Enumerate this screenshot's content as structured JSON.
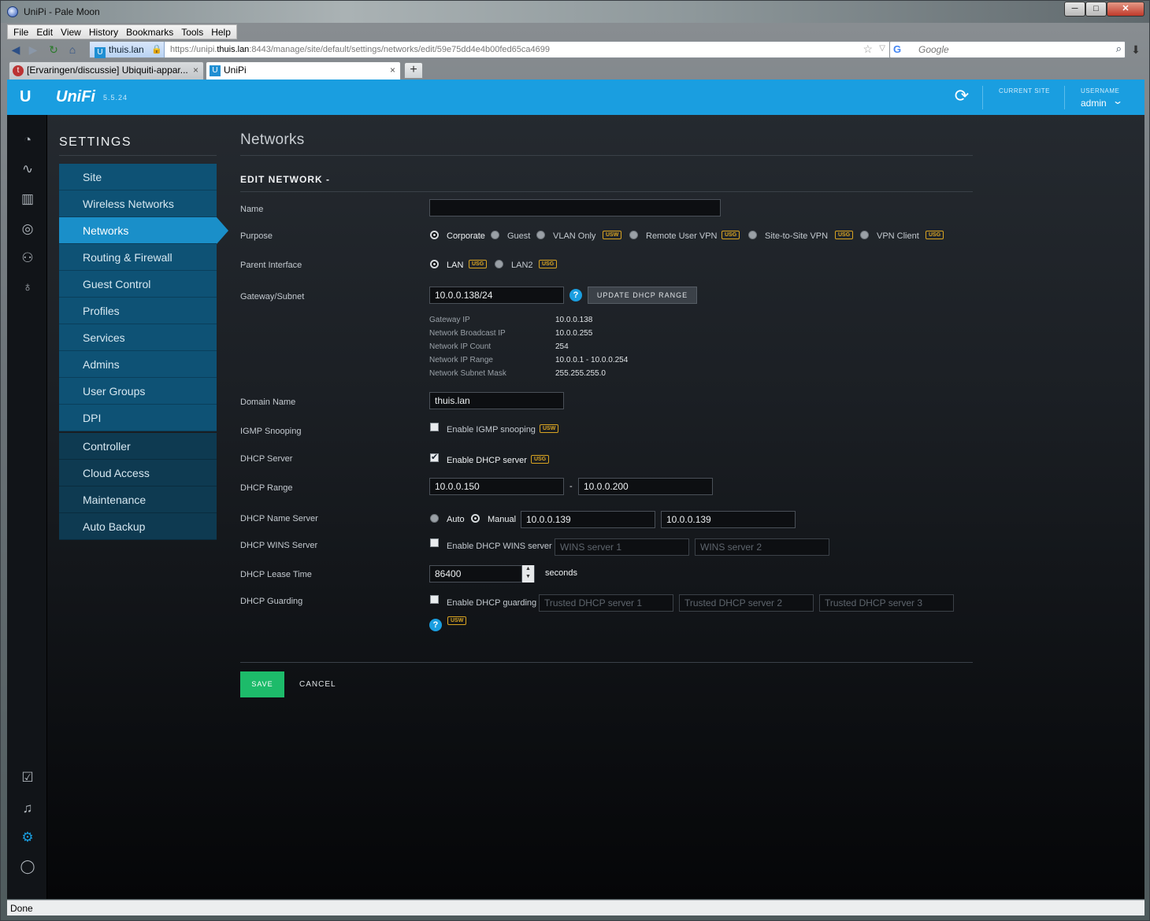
{
  "window": {
    "title": "UniPi - Pale Moon",
    "min": "─",
    "max": "□",
    "close": "✕"
  },
  "menu": [
    "File",
    "Edit",
    "View",
    "History",
    "Bookmarks",
    "Tools",
    "Help"
  ],
  "nav": {
    "identity": "thuis.lan",
    "url_prefix": "https://unipi.",
    "url_host": "thuis.lan",
    "url_rest": ":8443/manage/site/default/settings/networks/edit/59e75dd4e4b00fed65ca4699",
    "search_placeholder": "Google"
  },
  "tabs": [
    {
      "label": "[Ervaringen/discussie] Ubiquiti-appar...",
      "icon": "tweakers-icon"
    },
    {
      "label": "UniPi",
      "icon": "unifi-icon"
    }
  ],
  "app": {
    "logo": "UniFi",
    "version": "5.5.24",
    "current_site_label": "CURRENT SITE",
    "username_label": "USERNAME",
    "username": "admin"
  },
  "settings": {
    "title": "SETTINGS",
    "menu_top": [
      "Site",
      "Wireless Networks",
      "Networks",
      "Routing & Firewall",
      "Guest Control",
      "Profiles",
      "Services",
      "Admins",
      "User Groups",
      "DPI"
    ],
    "menu_bottom": [
      "Controller",
      "Cloud Access",
      "Maintenance",
      "Auto Backup"
    ],
    "active": "Networks"
  },
  "page": {
    "title": "Networks",
    "section": "EDIT NETWORK -",
    "labels": {
      "name": "Name",
      "purpose": "Purpose",
      "parent": "Parent Interface",
      "gateway": "Gateway/Subnet",
      "domain": "Domain Name",
      "igmp": "IGMP Snooping",
      "dhcp_server": "DHCP Server",
      "dhcp_range": "DHCP Range",
      "dhcp_ns": "DHCP Name Server",
      "dhcp_wins": "DHCP WINS Server",
      "dhcp_lease": "DHCP Lease Time",
      "dhcp_guard": "DHCP Guarding"
    },
    "name_value": "",
    "purpose": {
      "corporate": "Corporate",
      "guest": "Guest",
      "vlan_only": "VLAN Only",
      "remote_vpn": "Remote User VPN",
      "site_vpn": "Site-to-Site VPN",
      "vpn_client": "VPN Client"
    },
    "badges": {
      "usw": "USW",
      "usg": "USG"
    },
    "parent": {
      "lan": "LAN",
      "lan2": "LAN2"
    },
    "gateway_value": "10.0.0.138/24",
    "update_dhcp": "UPDATE DHCP RANGE",
    "info": {
      "gateway_ip_label": "Gateway IP",
      "gateway_ip": "10.0.0.138",
      "broadcast_label": "Network Broadcast IP",
      "broadcast": "10.0.0.255",
      "count_label": "Network IP Count",
      "count": "254",
      "range_label": "Network IP Range",
      "range": "10.0.0.1 - 10.0.0.254",
      "mask_label": "Network Subnet Mask",
      "mask": "255.255.255.0"
    },
    "domain_value": "thuis.lan",
    "igmp_text": "Enable IGMP snooping",
    "dhcp_server_text": "Enable DHCP server",
    "dhcp_range_start": "10.0.0.150",
    "dhcp_range_sep": "-",
    "dhcp_range_end": "10.0.0.200",
    "ns_auto": "Auto",
    "ns_manual": "Manual",
    "ns_1": "10.0.0.139",
    "ns_2": "10.0.0.139",
    "wins_text": "Enable DHCP WINS server",
    "wins_1_ph": "WINS server 1",
    "wins_2_ph": "WINS server 2",
    "lease_value": "86400",
    "lease_unit": "seconds",
    "guard_text": "Enable DHCP guarding",
    "trusted_1_ph": "Trusted DHCP server 1",
    "trusted_2_ph": "Trusted DHCP server 2",
    "trusted_3_ph": "Trusted DHCP server 3",
    "save": "SAVE",
    "cancel": "CANCEL"
  },
  "status": "Done"
}
